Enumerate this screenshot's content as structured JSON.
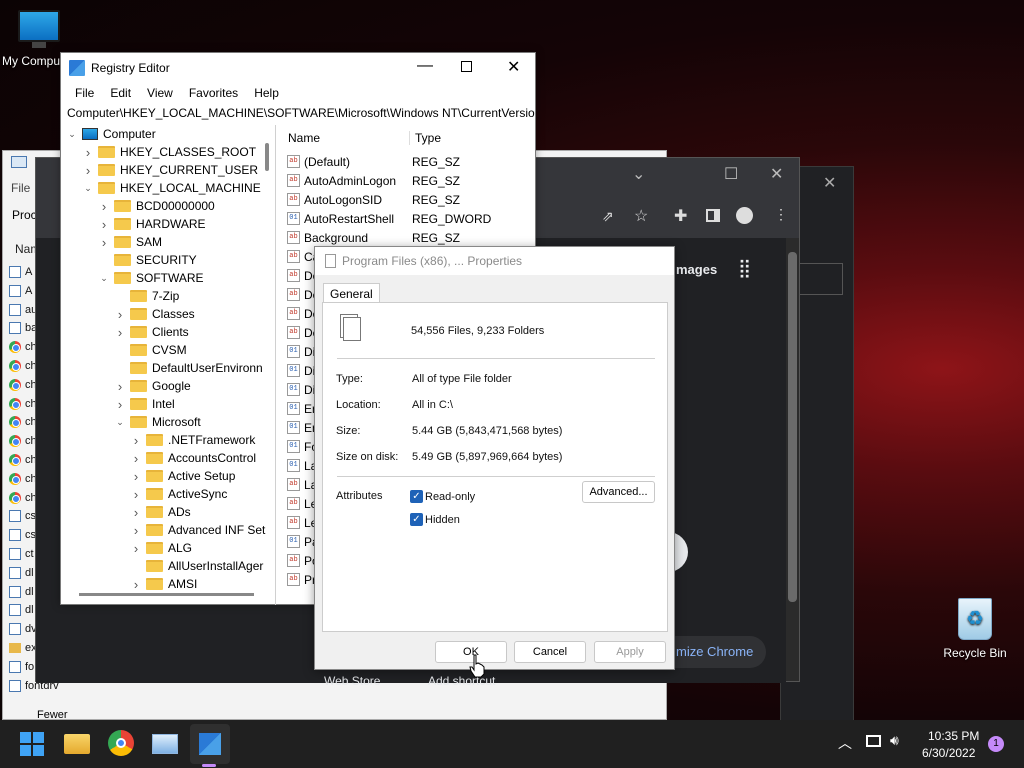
{
  "desktop": {
    "my_computer": "My Compu",
    "recycle_bin": "Recycle Bin"
  },
  "explorer": {
    "menu_file": "File",
    "proc_label": "Proc",
    "name_header": "Nam",
    "rows": [
      "A",
      "A",
      "au",
      "ba",
      "ch",
      "ch",
      "ch",
      "ch",
      "ch",
      "ch",
      "ch",
      "ch",
      "ch",
      "cs",
      "cs",
      "ct",
      "dl",
      "dl",
      "dl",
      "dv",
      "ex",
      "fo",
      "fontdrv"
    ],
    "fewer": "Fewer"
  },
  "chrome": {
    "images_label": "mages",
    "customize_label": "mize Chrome",
    "web_store": "Web Store",
    "add_shortcut": "Add shortcut"
  },
  "regedit": {
    "title": "Registry Editor",
    "menu": [
      "File",
      "Edit",
      "View",
      "Favorites",
      "Help"
    ],
    "address": "Computer\\HKEY_LOCAL_MACHINE\\SOFTWARE\\Microsoft\\Windows NT\\CurrentVersion\\",
    "tree": [
      {
        "label": "Computer",
        "depth": 0,
        "exp": "open",
        "icon": "computer"
      },
      {
        "label": "HKEY_CLASSES_ROOT",
        "depth": 1,
        "exp": "closed",
        "icon": "folder"
      },
      {
        "label": "HKEY_CURRENT_USER",
        "depth": 1,
        "exp": "closed",
        "icon": "folder"
      },
      {
        "label": "HKEY_LOCAL_MACHINE",
        "depth": 1,
        "exp": "open",
        "icon": "folder"
      },
      {
        "label": "BCD00000000",
        "depth": 2,
        "exp": "closed",
        "icon": "folder"
      },
      {
        "label": "HARDWARE",
        "depth": 2,
        "exp": "closed",
        "icon": "folder"
      },
      {
        "label": "SAM",
        "depth": 2,
        "exp": "closed",
        "icon": "folder"
      },
      {
        "label": "SECURITY",
        "depth": 2,
        "exp": "none",
        "icon": "folder"
      },
      {
        "label": "SOFTWARE",
        "depth": 2,
        "exp": "open",
        "icon": "folder"
      },
      {
        "label": "7-Zip",
        "depth": 3,
        "exp": "none",
        "icon": "folder"
      },
      {
        "label": "Classes",
        "depth": 3,
        "exp": "closed",
        "icon": "folder"
      },
      {
        "label": "Clients",
        "depth": 3,
        "exp": "closed",
        "icon": "folder"
      },
      {
        "label": "CVSM",
        "depth": 3,
        "exp": "none",
        "icon": "folder"
      },
      {
        "label": "DefaultUserEnvironn",
        "depth": 3,
        "exp": "none",
        "icon": "folder"
      },
      {
        "label": "Google",
        "depth": 3,
        "exp": "closed",
        "icon": "folder"
      },
      {
        "label": "Intel",
        "depth": 3,
        "exp": "closed",
        "icon": "folder"
      },
      {
        "label": "Microsoft",
        "depth": 3,
        "exp": "open",
        "icon": "folder"
      },
      {
        "label": ".NETFramework",
        "depth": 4,
        "exp": "closed",
        "icon": "folder"
      },
      {
        "label": "AccountsControl",
        "depth": 4,
        "exp": "closed",
        "icon": "folder"
      },
      {
        "label": "Active Setup",
        "depth": 4,
        "exp": "closed",
        "icon": "folder"
      },
      {
        "label": "ActiveSync",
        "depth": 4,
        "exp": "closed",
        "icon": "folder"
      },
      {
        "label": "ADs",
        "depth": 4,
        "exp": "closed",
        "icon": "folder"
      },
      {
        "label": "Advanced INF Set",
        "depth": 4,
        "exp": "closed",
        "icon": "folder"
      },
      {
        "label": "ALG",
        "depth": 4,
        "exp": "closed",
        "icon": "folder"
      },
      {
        "label": "AllUserInstallAger",
        "depth": 4,
        "exp": "none",
        "icon": "folder"
      },
      {
        "label": "AMSI",
        "depth": 4,
        "exp": "closed",
        "icon": "folder"
      }
    ],
    "col_name": "Name",
    "col_type": "Type",
    "values": [
      {
        "name": "(Default)",
        "type": "REG_SZ",
        "kind": "sz"
      },
      {
        "name": "AutoAdminLogon",
        "type": "REG_SZ",
        "kind": "sz"
      },
      {
        "name": "AutoLogonSID",
        "type": "REG_SZ",
        "kind": "sz"
      },
      {
        "name": "AutoRestartShell",
        "type": "REG_DWORD",
        "kind": "dw"
      },
      {
        "name": "Background",
        "type": "REG_SZ",
        "kind": "sz"
      },
      {
        "name": "Ca",
        "type": "",
        "kind": "sz"
      },
      {
        "name": "De",
        "type": "",
        "kind": "sz"
      },
      {
        "name": "De",
        "type": "",
        "kind": "sz"
      },
      {
        "name": "De",
        "type": "",
        "kind": "sz"
      },
      {
        "name": "De",
        "type": "",
        "kind": "sz"
      },
      {
        "name": "Di",
        "type": "",
        "kind": "dw"
      },
      {
        "name": "Di",
        "type": "",
        "kind": "dw"
      },
      {
        "name": "Di",
        "type": "",
        "kind": "dw"
      },
      {
        "name": "En",
        "type": "",
        "kind": "dw"
      },
      {
        "name": "En",
        "type": "",
        "kind": "dw"
      },
      {
        "name": "Fo",
        "type": "",
        "kind": "dw"
      },
      {
        "name": "La",
        "type": "",
        "kind": "dw"
      },
      {
        "name": "La",
        "type": "",
        "kind": "sz"
      },
      {
        "name": "Le",
        "type": "",
        "kind": "sz"
      },
      {
        "name": "Le",
        "type": "",
        "kind": "sz"
      },
      {
        "name": "Pa",
        "type": "",
        "kind": "dw"
      },
      {
        "name": "Po",
        "type": "",
        "kind": "sz"
      },
      {
        "name": "Pr",
        "type": "",
        "kind": "sz"
      }
    ]
  },
  "props": {
    "title": "Program Files (x86), ... Properties",
    "tab": "General",
    "summary": "54,556 Files, 9,233 Folders",
    "type_label": "Type:",
    "type_value": "All of type File folder",
    "location_label": "Location:",
    "location_value": "All in C:\\",
    "size_label": "Size:",
    "size_value": "5.44 GB (5,843,471,568 bytes)",
    "disk_label": "Size on disk:",
    "disk_value": "5.49 GB (5,897,969,664 bytes)",
    "attributes_label": "Attributes",
    "readonly_label": "Read-only",
    "readonly_checked": true,
    "hidden_label": "Hidden",
    "hidden_checked": true,
    "advanced_button": "Advanced...",
    "ok_button": "OK",
    "cancel_button": "Cancel",
    "apply_button": "Apply"
  },
  "taskbar": {
    "time": "10:35 PM",
    "date": "6/30/2022",
    "notification_count": "1"
  }
}
